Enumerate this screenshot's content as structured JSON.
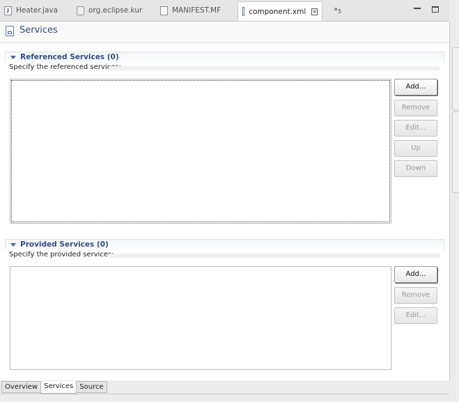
{
  "tabs": [
    {
      "label": "Heater.java",
      "icon": "java-file-icon"
    },
    {
      "label": "org.eclipse.kur",
      "icon": "plugin-icon"
    },
    {
      "label": "MANIFEST.MF",
      "icon": "manifest-file-icon"
    },
    {
      "label": "component.xml",
      "icon": "xml-file-icon",
      "active": true
    }
  ],
  "tab_overflow": {
    "glyph": "»",
    "count": "5"
  },
  "page": {
    "title": "Services"
  },
  "referenced": {
    "title": "Referenced Services (0)",
    "description": "Specify the referenced services:",
    "buttons": {
      "add": "Add...",
      "remove": "Remove",
      "edit": "Edit...",
      "up": "Up",
      "down": "Down"
    }
  },
  "provided": {
    "title": "Provided Services (0)",
    "description": "Specify the provided services:",
    "buttons": {
      "add": "Add...",
      "remove": "Remove",
      "edit": "Edit..."
    }
  },
  "bottom_tabs": [
    {
      "label": "Overview"
    },
    {
      "label": "Services",
      "active": true
    },
    {
      "label": "Source"
    }
  ],
  "colors": {
    "section_title": "#2d4d80",
    "disabled_text": "#9a9a9a"
  }
}
